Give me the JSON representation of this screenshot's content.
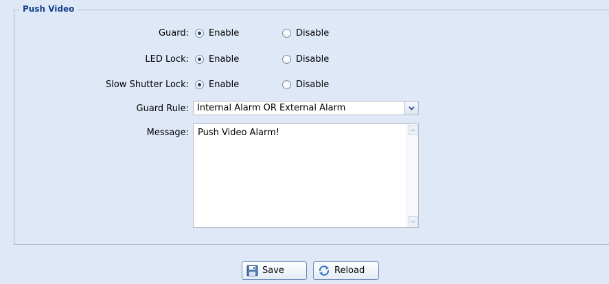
{
  "fieldset": {
    "legend": "Push Video"
  },
  "rows": [
    {
      "label": "Guard:",
      "enable": "Enable",
      "disable": "Disable",
      "selected": "enable"
    },
    {
      "label": "LED Lock:",
      "enable": "Enable",
      "disable": "Disable",
      "selected": "enable"
    },
    {
      "label": "Slow Shutter Lock:",
      "enable": "Enable",
      "disable": "Disable",
      "selected": "enable"
    }
  ],
  "guard_rule": {
    "label": "Guard Rule:",
    "value": "Internal Alarm OR External Alarm"
  },
  "message": {
    "label": "Message:",
    "value": "Push Video Alarm!"
  },
  "buttons": {
    "save": "Save",
    "reload": "Reload"
  },
  "colors": {
    "background": "#dfe8f6",
    "legend": "#15428b",
    "border": "#b5b8c8"
  },
  "icons": {
    "save": "floppy-disk-icon",
    "reload": "refresh-icon",
    "dropdown": "chevron-down-icon"
  }
}
